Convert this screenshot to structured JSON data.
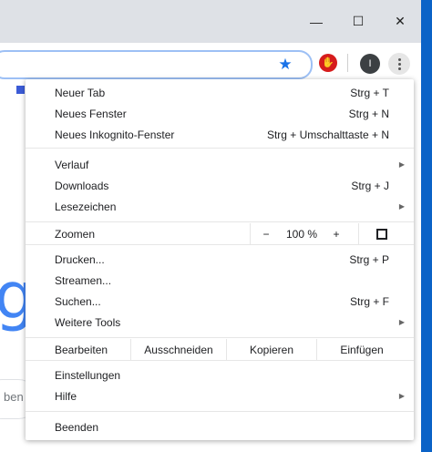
{
  "window": {
    "minimize": "—",
    "maximize": "☐",
    "close": "✕"
  },
  "toolbar": {
    "star_icon": "★",
    "extension_label": "✋",
    "profile_initial": "I"
  },
  "page": {
    "logo_letter": "g",
    "input_text": "ben"
  },
  "menu": {
    "group1": [
      {
        "label": "Neuer Tab",
        "shortcut": "Strg + T"
      },
      {
        "label": "Neues Fenster",
        "shortcut": "Strg + N"
      },
      {
        "label": "Neues Inkognito-Fenster",
        "shortcut": "Strg + Umschalttaste + N"
      }
    ],
    "group2": [
      {
        "label": "Verlauf",
        "shortcut": "",
        "submenu": true
      },
      {
        "label": "Downloads",
        "shortcut": "Strg + J",
        "submenu": false
      },
      {
        "label": "Lesezeichen",
        "shortcut": "",
        "submenu": true
      }
    ],
    "zoom": {
      "label": "Zoomen",
      "minus": "−",
      "value": "100 %",
      "plus": "+"
    },
    "group3": [
      {
        "label": "Drucken...",
        "shortcut": "Strg + P",
        "submenu": false
      },
      {
        "label": "Streamen...",
        "shortcut": "",
        "submenu": false
      },
      {
        "label": "Suchen...",
        "shortcut": "Strg + F",
        "submenu": false
      },
      {
        "label": "Weitere Tools",
        "shortcut": "",
        "submenu": true
      }
    ],
    "edit": {
      "label": "Bearbeiten",
      "cut": "Ausschneiden",
      "copy": "Kopieren",
      "paste": "Einfügen"
    },
    "group4": [
      {
        "label": "Einstellungen",
        "submenu": false
      },
      {
        "label": "Hilfe",
        "submenu": true
      }
    ],
    "exit": {
      "label": "Beenden"
    },
    "arrow": "▶"
  }
}
